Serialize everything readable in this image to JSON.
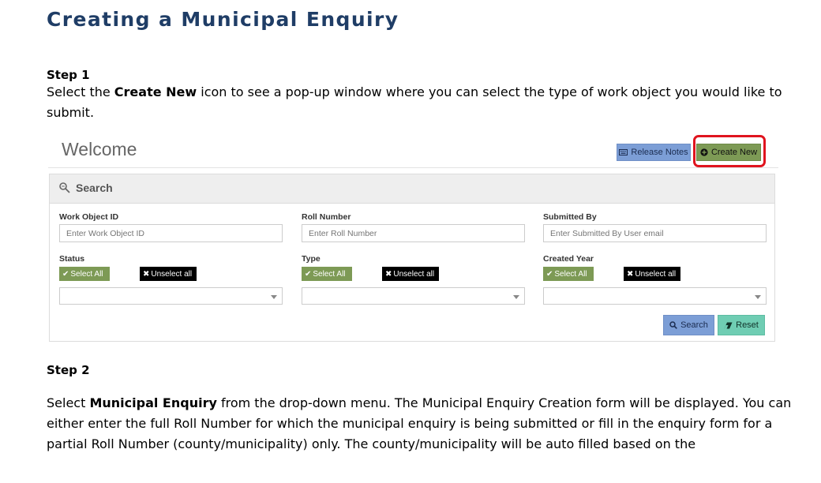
{
  "doc": {
    "title": "Creating a Municipal Enquiry",
    "step1": {
      "heading": "Step 1",
      "text_before": "Select the ",
      "bold": "Create New",
      "text_after_line1": " icon to see a pop-up window where you can select the type of work object you would like to",
      "text_line2": "submit."
    },
    "step2": {
      "heading": "Step 2",
      "line1_before": "Select ",
      "line1_bold": "Municipal Enquiry",
      "line1_after": " from the drop-down menu. The Municipal Enquiry Creation form will be displayed. You can",
      "line2": "either enter the full Roll Number for which the municipal enquiry is being submitted or fill in the enquiry form for a",
      "line3": "partial Roll Number (county/municipality) only. The county/municipality will be auto filled based on the"
    }
  },
  "screenshot": {
    "welcome": "Welcome",
    "release_notes_label": "Release Notes",
    "create_new_label": "Create New",
    "search_panel_title": "Search",
    "highlight_color": "#e0141e",
    "fields": {
      "work_object_id_label": "Work Object ID",
      "work_object_id_placeholder": "Enter Work Object ID",
      "roll_number_label": "Roll Number",
      "roll_number_placeholder": "Enter Roll Number",
      "submitted_by_label": "Submitted By",
      "submitted_by_placeholder": "Enter Submitted By User email",
      "status_label": "Status",
      "type_label": "Type",
      "created_year_label": "Created Year",
      "select_all_label": "Select All",
      "unselect_all_label": "Unselect all"
    },
    "search_button_label": "Search",
    "reset_button_label": "Reset",
    "icons": {
      "release_notes": "keyboard-icon",
      "create_new": "plus-circle-icon",
      "search_panel": "search-icon",
      "select_all": "check-icon",
      "unselect_all": "x-icon",
      "search_button": "magnifier-icon",
      "reset_button": "eraser-icon"
    }
  }
}
